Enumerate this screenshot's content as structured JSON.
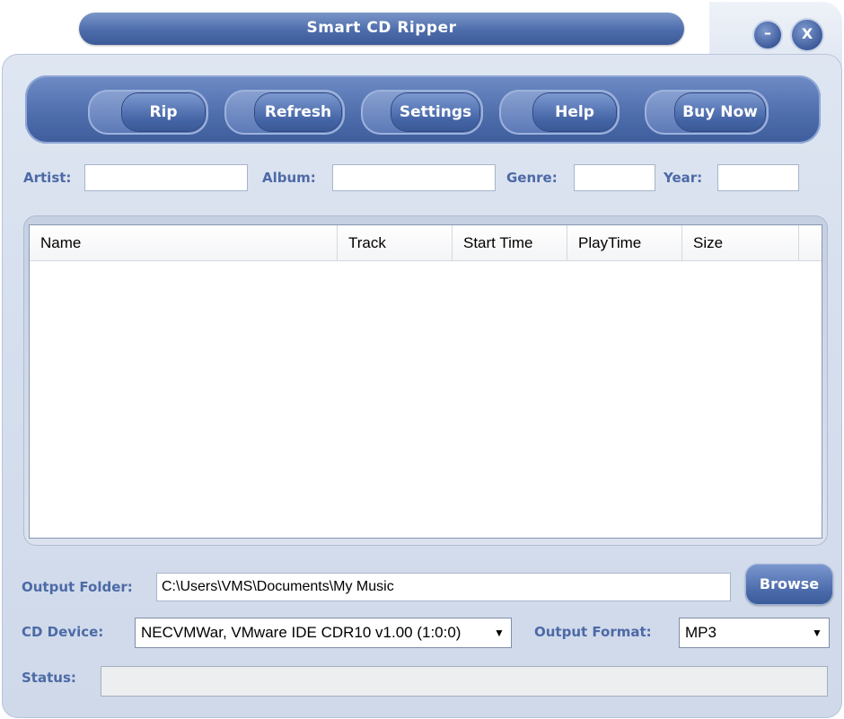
{
  "window": {
    "title": "Smart CD Ripper",
    "minimize_label": "–",
    "close_label": "X"
  },
  "toolbar": {
    "rip": "Rip",
    "refresh": "Refresh",
    "settings": "Settings",
    "help": "Help",
    "buy_now": "Buy Now"
  },
  "info": {
    "artist_label": "Artist:",
    "artist_value": "",
    "album_label": "Album:",
    "album_value": "",
    "genre_label": "Genre:",
    "genre_value": "",
    "year_label": "Year:",
    "year_value": ""
  },
  "tracklist": {
    "columns": [
      "Name",
      "Track",
      "Start Time",
      "PlayTime",
      "Size"
    ],
    "rows": []
  },
  "output": {
    "folder_label": "Output Folder:",
    "folder_value": "C:\\Users\\VMS\\Documents\\My Music",
    "browse_label": "Browse",
    "cd_device_label": "CD Device:",
    "cd_device_value": "NECVMWar, VMware IDE CDR10 v1.00 (1:0:0)",
    "format_label": "Output Format:",
    "format_value": "MP3",
    "status_label": "Status:",
    "status_value": ""
  },
  "colors": {
    "accent": "#4d6cab",
    "label": "#4d6aa6",
    "background": "#d6dfee"
  },
  "icons": {
    "dropdown": "chevron-down-icon"
  }
}
